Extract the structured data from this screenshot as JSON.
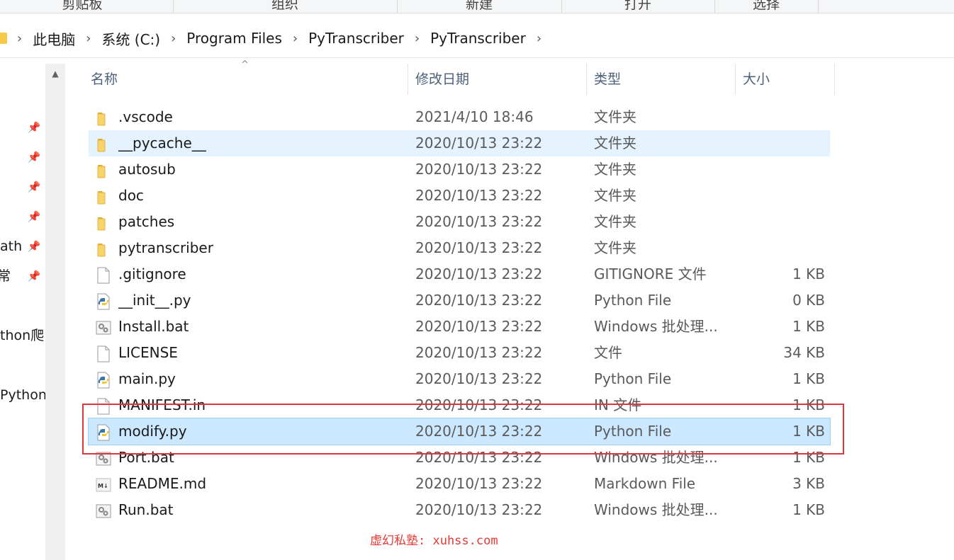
{
  "ribbon": {
    "groups": [
      "剪贴板",
      "组织",
      "新建",
      "打开",
      "选择"
    ]
  },
  "breadcrumb": {
    "items": [
      "此电脑",
      "系统 (C:)",
      "Program Files",
      "PyTranscriber",
      "PyTranscriber"
    ],
    "separator": "›"
  },
  "nav": {
    "items": [
      "ath",
      "常",
      "thon爬",
      "Python"
    ]
  },
  "columns": {
    "name": "名称",
    "date": "修改日期",
    "type": "类型",
    "size": "大小"
  },
  "files": [
    {
      "name": ".vscode",
      "date": "2021/4/10 18:46",
      "type": "文件夹",
      "size": "",
      "icon": "folder"
    },
    {
      "name": "__pycache__",
      "date": "2020/10/13 23:22",
      "type": "文件夹",
      "size": "",
      "icon": "folder"
    },
    {
      "name": "autosub",
      "date": "2020/10/13 23:22",
      "type": "文件夹",
      "size": "",
      "icon": "folder"
    },
    {
      "name": "doc",
      "date": "2020/10/13 23:22",
      "type": "文件夹",
      "size": "",
      "icon": "folder"
    },
    {
      "name": "patches",
      "date": "2020/10/13 23:22",
      "type": "文件夹",
      "size": "",
      "icon": "folder"
    },
    {
      "name": "pytranscriber",
      "date": "2020/10/13 23:22",
      "type": "文件夹",
      "size": "",
      "icon": "folder"
    },
    {
      "name": ".gitignore",
      "date": "2020/10/13 23:22",
      "type": "GITIGNORE 文件",
      "size": "1 KB",
      "icon": "file"
    },
    {
      "name": "__init__.py",
      "date": "2020/10/13 23:22",
      "type": "Python File",
      "size": "0 KB",
      "icon": "python"
    },
    {
      "name": "Install.bat",
      "date": "2020/10/13 23:22",
      "type": "Windows 批处理...",
      "size": "1 KB",
      "icon": "batch"
    },
    {
      "name": "LICENSE",
      "date": "2020/10/13 23:22",
      "type": "文件",
      "size": "34 KB",
      "icon": "file"
    },
    {
      "name": "main.py",
      "date": "2020/10/13 23:22",
      "type": "Python File",
      "size": "1 KB",
      "icon": "python"
    },
    {
      "name": "MANIFEST.in",
      "date": "2020/10/13 23:22",
      "type": "IN 文件",
      "size": "1 KB",
      "icon": "file"
    },
    {
      "name": "modify.py",
      "date": "2020/10/13 23:22",
      "type": "Python File",
      "size": "1 KB",
      "icon": "python"
    },
    {
      "name": "Port.bat",
      "date": "2020/10/13 23:22",
      "type": "Windows 批处理...",
      "size": "1 KB",
      "icon": "batch"
    },
    {
      "name": "README.md",
      "date": "2020/10/13 23:22",
      "type": "Markdown File",
      "size": "3 KB",
      "icon": "markdown"
    },
    {
      "name": "Run.bat",
      "date": "2020/10/13 23:22",
      "type": "Windows 批处理...",
      "size": "1 KB",
      "icon": "batch"
    }
  ],
  "state": {
    "hover_file": "__pycache__",
    "selected_file": "modify.py"
  },
  "watermark": "虚幻私塾: xuhss.com",
  "colors": {
    "hover": "#e5f3ff",
    "selected": "#cce8ff",
    "highlight_box": "#d9363e",
    "folder": "#f7c948"
  }
}
